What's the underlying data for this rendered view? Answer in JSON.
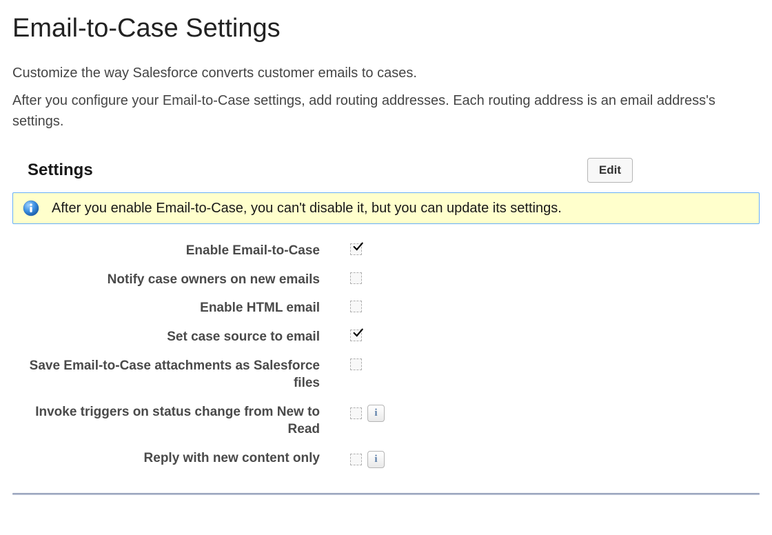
{
  "page": {
    "title": "Email-to-Case Settings",
    "desc1": "Customize the way Salesforce converts customer emails to cases.",
    "desc2": "After you configure your Email-to-Case settings, add routing addresses. Each routing address is an email address's settings."
  },
  "section": {
    "title": "Settings",
    "edit_label": "Edit",
    "banner": "After you enable Email-to-Case, you can't disable it, but you can update its settings."
  },
  "settings": {
    "r0": {
      "label": "Enable Email-to-Case"
    },
    "r1": {
      "label": "Notify case owners on new emails"
    },
    "r2": {
      "label": "Enable HTML email"
    },
    "r3": {
      "label": "Set case source to email"
    },
    "r4": {
      "label": "Save Email-to-Case attachments as Salesforce files"
    },
    "r5": {
      "label": "Invoke triggers on status change from New to Read"
    },
    "r6": {
      "label": "Reply with new content only"
    }
  },
  "help_glyph": "i"
}
